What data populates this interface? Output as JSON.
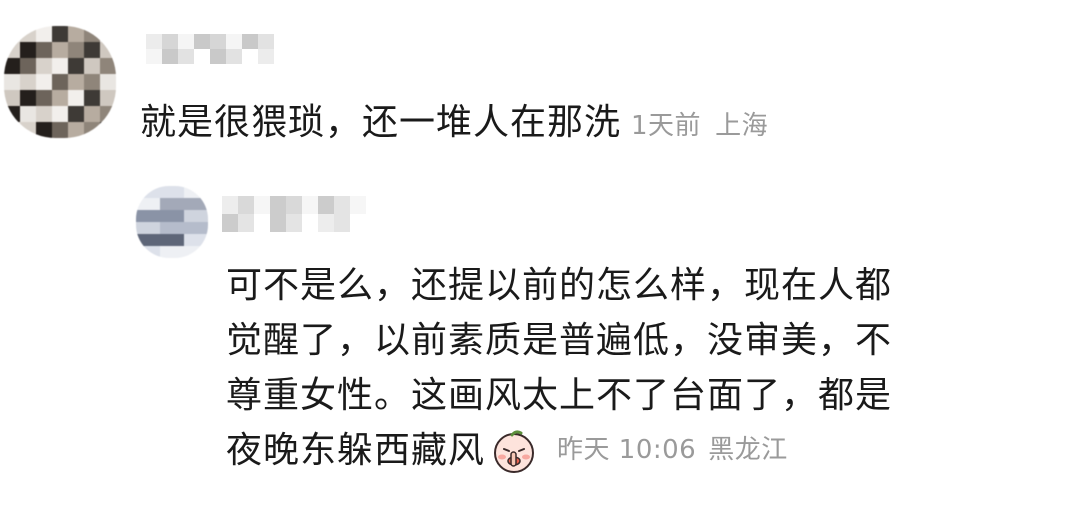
{
  "comment": {
    "text": "就是很猥琐，还一堆人在那洗",
    "time": "1天前",
    "location": "上海"
  },
  "reply": {
    "lines": [
      "可不是么，还提以前的怎么样，现在人都",
      "觉醒了，以前素质是普遍低，没审美，不",
      "尊重女性。这画风太上不了台面了，都是",
      "夜晚东躲西藏风"
    ],
    "emoji": "peach-shush-emoji",
    "time": "昨天 10:06",
    "location": "黑龙江"
  },
  "colors": {
    "text": "#1a1a1a",
    "meta": "#9a9a9a",
    "background": "#ffffff"
  }
}
